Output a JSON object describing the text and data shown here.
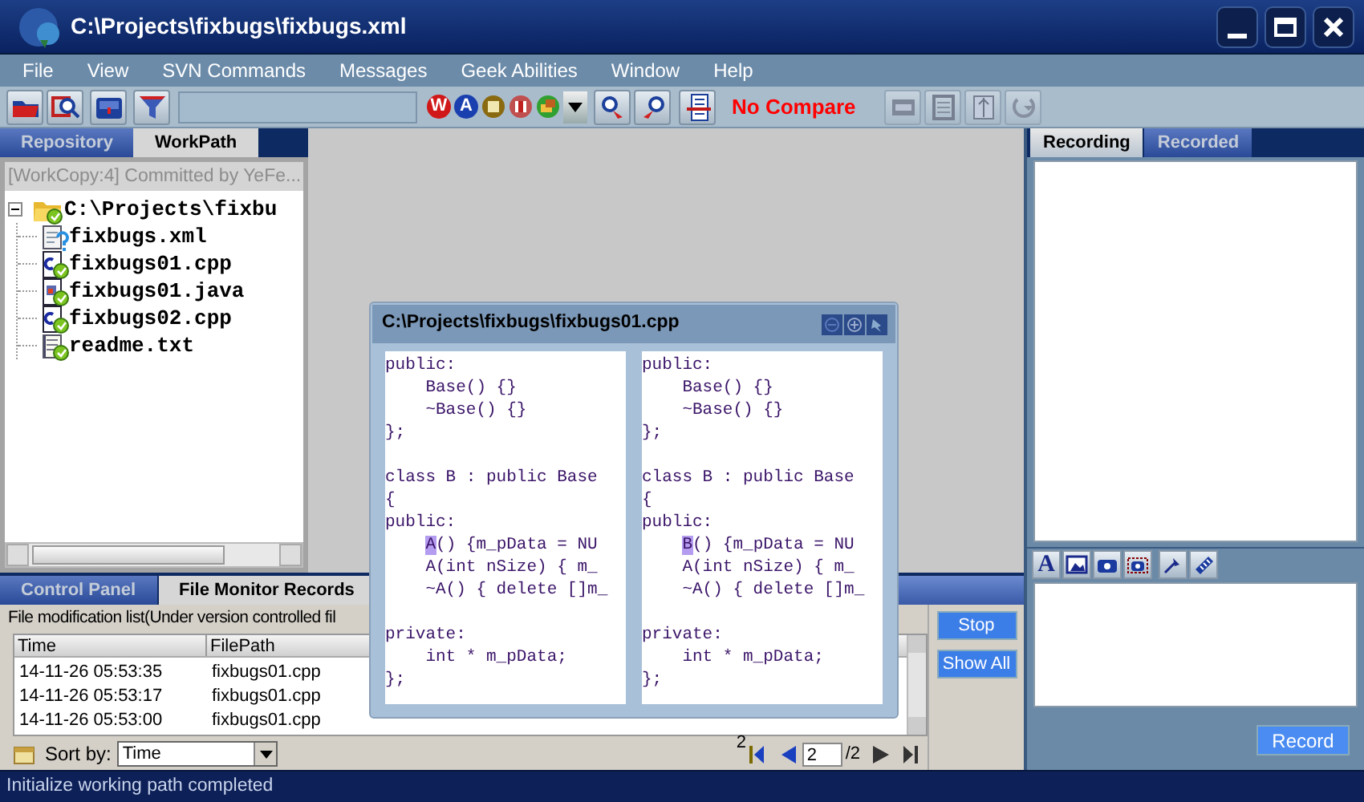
{
  "window": {
    "title": "C:\\Projects\\fixbugs\\fixbugs.xml"
  },
  "menu": [
    "File",
    "View",
    "SVN Commands",
    "Messages",
    "Geek Abilities",
    "Window",
    "Help"
  ],
  "toolbar": {
    "mode_letters": [
      "W",
      "A"
    ],
    "compare_status": "No Compare",
    "view_buttons": [
      {
        "disabled": true
      },
      {
        "disabled": true
      },
      {
        "disabled": true
      },
      {
        "disabled": true
      }
    ]
  },
  "left_panel": {
    "tabs": [
      {
        "label": "Repository",
        "selected": false
      },
      {
        "label": "WorkPath",
        "selected": true
      }
    ],
    "header": "[WorkCopy:4] Committed by YeFe...",
    "tree": [
      {
        "label": "C:\\Projects\\fixbu",
        "kind": "folder",
        "committed": true,
        "expanded": true,
        "children": [
          {
            "label": "fixbugs.xml",
            "kind": "xml",
            "committed": false
          },
          {
            "label": "fixbugs01.cpp",
            "kind": "cpp",
            "committed": true
          },
          {
            "label": "fixbugs01.java",
            "kind": "java",
            "committed": true
          },
          {
            "label": "fixbugs02.cpp",
            "kind": "cpp",
            "committed": true
          },
          {
            "label": "readme.txt",
            "kind": "txt",
            "committed": true
          }
        ]
      }
    ]
  },
  "compare_window": {
    "title": "C:\\Projects\\fixbugs\\fixbugs01.cpp",
    "panes": [
      {
        "lines": [
          {
            "kind": "code",
            "text": "public:"
          },
          {
            "kind": "code",
            "text": "    Base() {}"
          },
          {
            "kind": "code",
            "text": "    ~Base() {}"
          },
          {
            "kind": "code",
            "text": "};"
          },
          {
            "kind": "blank"
          },
          {
            "kind": "code",
            "text": "class B : public Base"
          },
          {
            "kind": "code",
            "text": "{"
          },
          {
            "kind": "code",
            "text": "public:"
          },
          {
            "kind": "diff",
            "diff": "A",
            "text": "() {m_pData = NU"
          },
          {
            "kind": "code",
            "text": "    A(int nSize) { m_"
          },
          {
            "kind": "code",
            "text": "    ~A() { delete []m_"
          },
          {
            "kind": "blank"
          },
          {
            "kind": "code",
            "text": "private:"
          },
          {
            "kind": "code",
            "text": "    int * m_pData;"
          },
          {
            "kind": "code",
            "text": "};"
          }
        ]
      },
      {
        "lines": [
          {
            "kind": "code",
            "text": "public:"
          },
          {
            "kind": "code",
            "text": "    Base() {}"
          },
          {
            "kind": "code",
            "text": "    ~Base() {}"
          },
          {
            "kind": "code",
            "text": "};"
          },
          {
            "kind": "blank"
          },
          {
            "kind": "code",
            "text": "class B : public Base"
          },
          {
            "kind": "code",
            "text": "{"
          },
          {
            "kind": "code",
            "text": "public:"
          },
          {
            "kind": "diff",
            "diff": "B",
            "text": "() {m_pData = NU"
          },
          {
            "kind": "code",
            "text": "    A(int nSize) { m_"
          },
          {
            "kind": "code",
            "text": "    ~A() { delete []m_"
          },
          {
            "kind": "blank"
          },
          {
            "kind": "code",
            "text": "private:"
          },
          {
            "kind": "code",
            "text": "    int * m_pData;"
          },
          {
            "kind": "code",
            "text": "};"
          }
        ]
      }
    ]
  },
  "bottom_panel": {
    "tabs": [
      {
        "label": "Control Panel",
        "selected": false
      },
      {
        "label": "File Monitor Records",
        "selected": true
      }
    ],
    "description": "File modification list(Under version controlled fil",
    "table": {
      "columns": [
        "Time",
        "FilePath"
      ],
      "rows": [
        [
          "14-11-26 05:53:35",
          "fixbugs01.cpp"
        ],
        [
          "14-11-26 05:53:17",
          "fixbugs01.cpp"
        ],
        [
          "14-11-26 05:53:00",
          "fixbugs01.cpp"
        ]
      ]
    },
    "count": "2",
    "buttons": [
      "Stop",
      "Show All"
    ],
    "sort": {
      "label": "Sort by:",
      "value": "Time"
    },
    "pager": {
      "value": "2",
      "total": "/2"
    }
  },
  "right_panel": {
    "tabs": [
      {
        "label": "Recording",
        "selected": true
      },
      {
        "label": "Recorded",
        "selected": false
      }
    ],
    "tools_letter": "A",
    "button": "Record"
  },
  "status_bar": "Initialize working path completed"
}
